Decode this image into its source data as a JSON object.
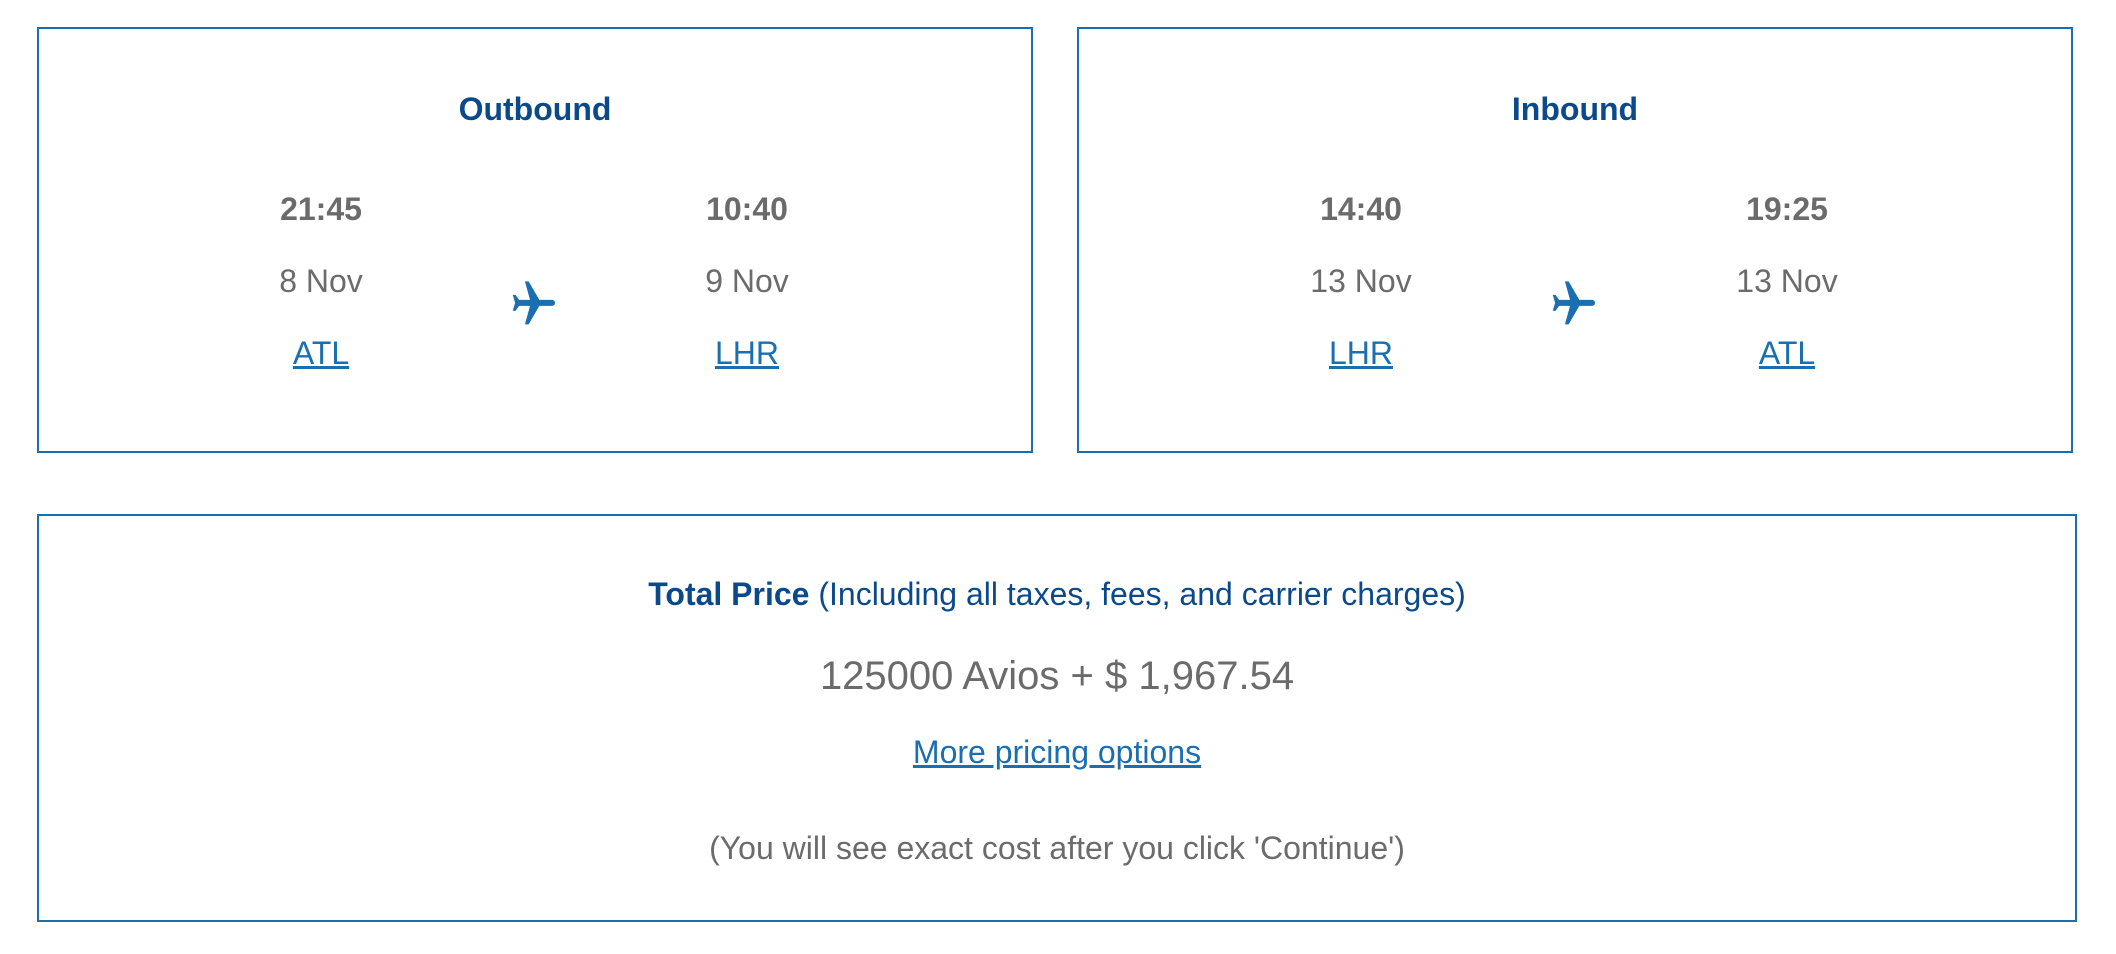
{
  "outbound": {
    "title": "Outbound",
    "departure": {
      "time": "21:45",
      "date": "8 Nov",
      "airport": "ATL"
    },
    "arrival": {
      "time": "10:40",
      "date": "9 Nov",
      "airport": "LHR"
    },
    "icon": "airplane-icon"
  },
  "inbound": {
    "title": "Inbound",
    "departure": {
      "time": "14:40",
      "date": "13 Nov",
      "airport": "LHR"
    },
    "arrival": {
      "time": "19:25",
      "date": "13 Nov",
      "airport": "ATL"
    },
    "icon": "airplane-icon"
  },
  "price": {
    "heading_strong": "Total Price",
    "heading_note": "(Including all taxes, fees, and carrier charges)",
    "value": "125000 Avios + $ 1,967.54",
    "more_options_link": "More pricing options",
    "note": "(You will see exact cost after you click 'Continue')"
  },
  "colors": {
    "accent": "#1a6fb0",
    "heading": "#0b4a8a",
    "text": "#6b6b6b"
  }
}
